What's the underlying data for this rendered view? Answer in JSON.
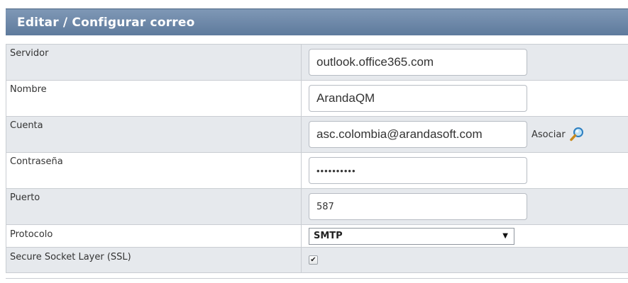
{
  "header": {
    "title": "Editar / Configurar correo"
  },
  "fields": {
    "servidor": {
      "label": "Servidor",
      "value": "outlook.office365.com"
    },
    "nombre": {
      "label": "Nombre",
      "value": "ArandaQM"
    },
    "cuenta": {
      "label": "Cuenta",
      "value": "asc.colombia@arandasoft.com",
      "action_label": "Asociar",
      "action_icon": "search-icon"
    },
    "contrasena": {
      "label": "Contraseña",
      "value": "••••••••••"
    },
    "puerto": {
      "label": "Puerto",
      "value": "587"
    },
    "protocolo": {
      "label": "Protocolo",
      "selected": "SMTP"
    },
    "ssl": {
      "label": "Secure Socket Layer (SSL)",
      "checked": true
    }
  },
  "colors": {
    "header_bg": "#6c87a8",
    "row_alt_bg": "#e6e9ed",
    "border": "#c9cdd2"
  }
}
